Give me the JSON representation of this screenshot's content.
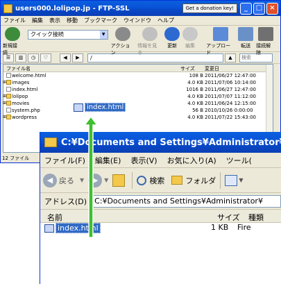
{
  "ftp": {
    "title": "users000.lolipop.jp - FTP-SSL",
    "donate": "Get a donation key!",
    "menu": [
      "ファイル",
      "編集",
      "表示",
      "移動",
      "ブックマーク",
      "ウインドウ",
      "ヘルプ"
    ],
    "toolbar": {
      "new_connection": "新規接続",
      "quick_connect": "クイック接続",
      "action": "アクション",
      "info": "情報を見る",
      "refresh": "更新",
      "edit": "編集",
      "upload": "アップロード",
      "transfer": "転送",
      "disconnect": "接続解除"
    },
    "path": "/",
    "search_placeholder": "検索",
    "columns": {
      "name": "ファイル名",
      "size": "サイズ",
      "modified": "変更日"
    },
    "files": [
      {
        "name": "welcome.html",
        "type": "file",
        "size": "108 B",
        "date": "2011/06/27 12:47:00"
      },
      {
        "name": "images",
        "type": "folder",
        "size": "4.0 KB",
        "date": "2011/07/06 10:14:00"
      },
      {
        "name": "index.html",
        "type": "file",
        "size": "1016 B",
        "date": "2011/06/27 12:47:00"
      },
      {
        "name": "lolipop",
        "type": "folder",
        "size": "4.0 KB",
        "date": "2011/07/07 11:12:00"
      },
      {
        "name": "movies",
        "type": "folder",
        "size": "4.0 KB",
        "date": "2011/06/24 12:15:00"
      },
      {
        "name": "system.php",
        "type": "file",
        "size": "56 B",
        "date": "2010/10/26 0:00:00"
      },
      {
        "name": "wordpress",
        "type": "folder",
        "size": "4.0 KB",
        "date": "2011/07/22 15:43:00"
      }
    ],
    "status": "12 ファイル",
    "drag_label": "index.html"
  },
  "explorer": {
    "title": "C:¥Documents and Settings¥Administrator¥",
    "menu": [
      "ファイル(F)",
      "編集(E)",
      "表示(V)",
      "お気に入り(A)",
      "ツール("
    ],
    "toolbar": {
      "back": "戻る",
      "search": "検索",
      "folders": "フォルダ"
    },
    "address_label": "アドレス(D)",
    "address": "C:¥Documents and Settings¥Administrator¥",
    "columns": {
      "name": "名前",
      "size": "サイズ",
      "type": "種類"
    },
    "file": {
      "name": "index.html",
      "size": "1 KB",
      "type": "Fire"
    }
  },
  "colors": {
    "title_blue": "#0a54d8",
    "selection": "#316ac5",
    "arrow_green": "#3fbf2f"
  }
}
